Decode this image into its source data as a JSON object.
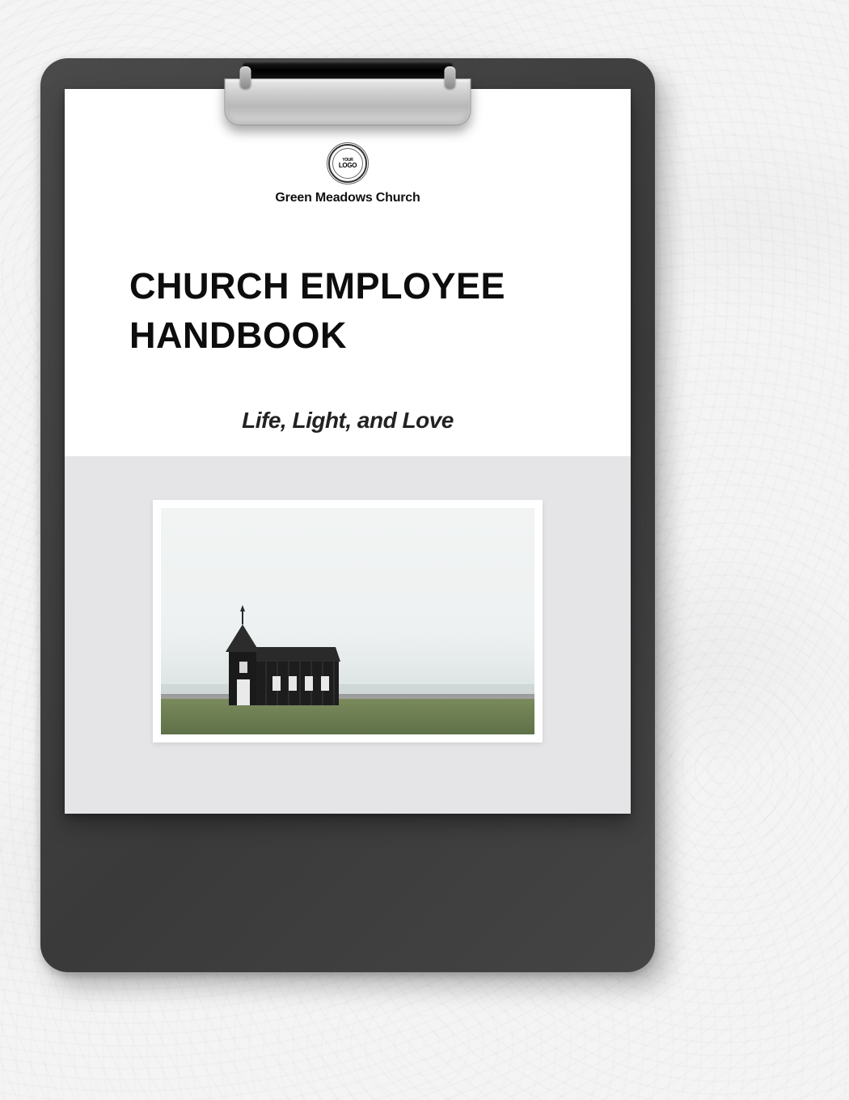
{
  "logo": {
    "top_text": "YOUR",
    "main_text": "LOGO",
    "bottom_text": ""
  },
  "organization_name": "Green Meadows Church",
  "document_title_line1": "CHURCH EMPLOYEE",
  "document_title_line2": "HANDBOOK",
  "tagline": "Life, Light, and Love",
  "image_description": "Small black church with steeple on green field under overcast sky",
  "colors": {
    "clipboard": "#3f3f3f",
    "paper_top": "#ffffff",
    "paper_bottom": "#e5e5e7",
    "text": "#111111"
  }
}
